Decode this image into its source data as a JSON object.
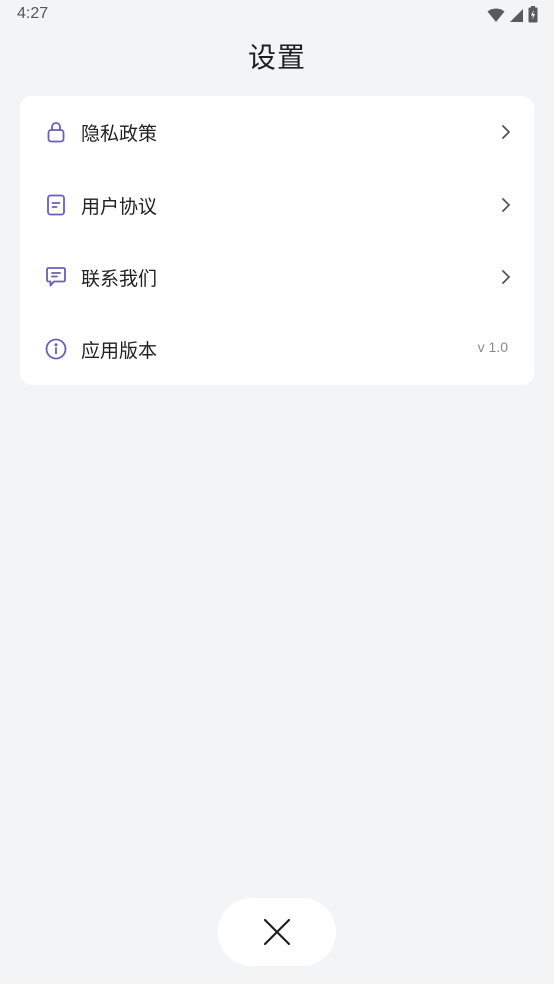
{
  "status_bar": {
    "time": "4:27",
    "icons": [
      "wifi-icon",
      "cellular-signal-icon",
      "battery-icon"
    ]
  },
  "header": {
    "title": "设置"
  },
  "settings": {
    "items": [
      {
        "label": "隐私政策",
        "icon": "lock-icon",
        "trailing": "chevron-right-icon"
      },
      {
        "label": "用户协议",
        "icon": "document-icon",
        "trailing": "chevron-right-icon"
      },
      {
        "label": "联系我们",
        "icon": "chat-icon",
        "trailing": "chevron-right-icon"
      },
      {
        "label": "应用版本",
        "icon": "info-icon",
        "trailing_text": "v 1.0"
      }
    ]
  },
  "actions": {
    "close_icon": "close-icon"
  },
  "colors": {
    "background": "#f3f4f6",
    "card": "#ffffff",
    "icon_accent": "#6a5fb5",
    "text": "#222222",
    "secondary_text": "#8a8a8a"
  }
}
